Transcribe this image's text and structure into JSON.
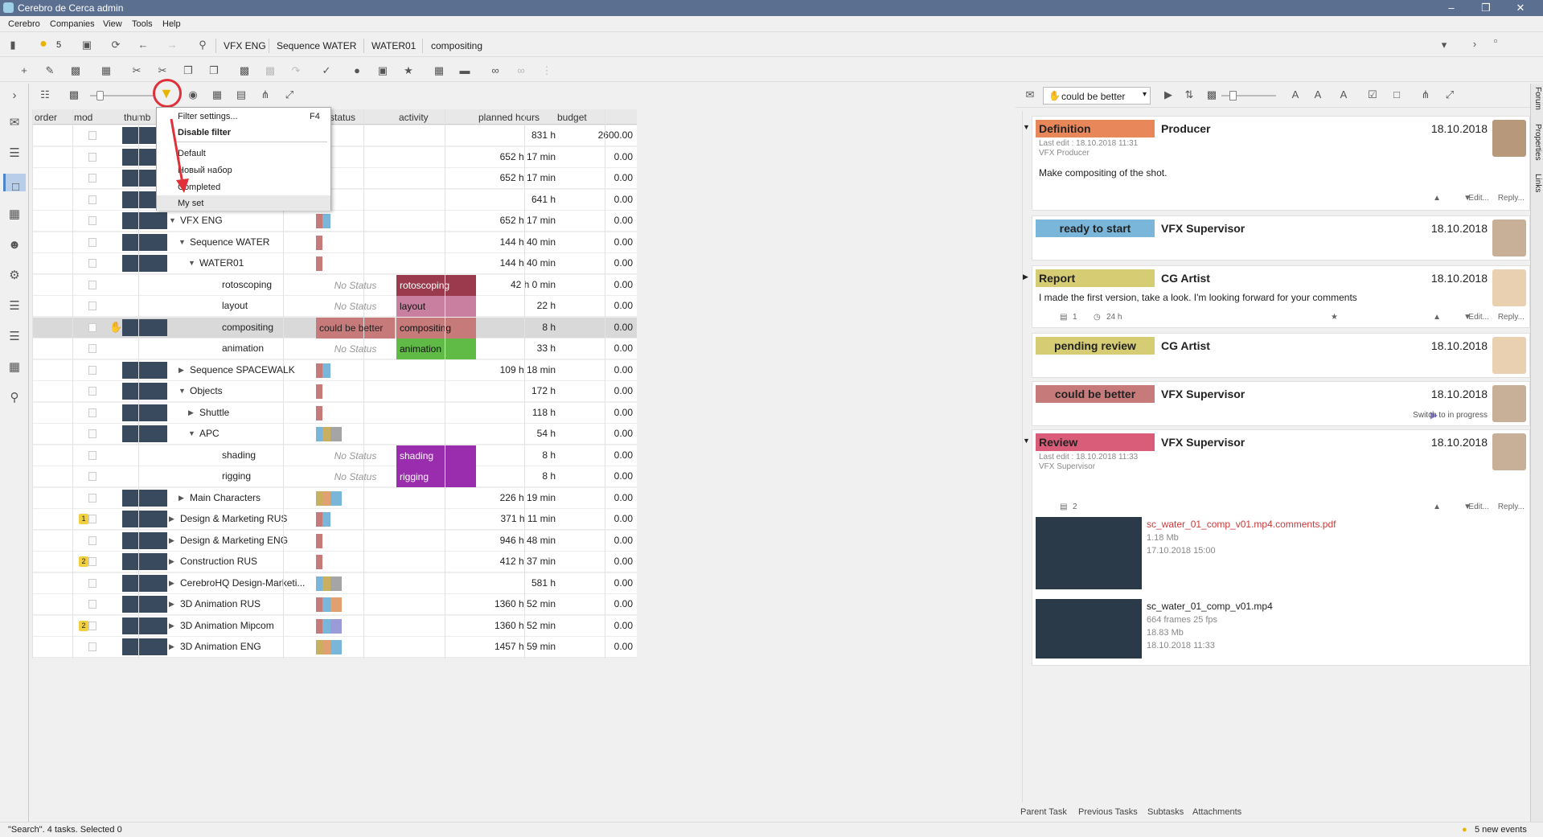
{
  "app": {
    "title": "Cerebro de Cerca  admin"
  },
  "menu": [
    "Cerebro",
    "Companies",
    "View",
    "Tools",
    "Help"
  ],
  "address": {
    "badge": "5",
    "crumbs": [
      "VFX ENG",
      "Sequence WATER",
      "WATER01",
      "compositing"
    ]
  },
  "columns": [
    "order",
    "mod",
    "thumb",
    "status",
    "activity",
    "planned hours",
    "budget"
  ],
  "filter_menu": {
    "items": [
      "Filter settings...",
      "Disable filter",
      "Default",
      "Новый набор",
      "Completed",
      "My set"
    ],
    "shortcut": "F4"
  },
  "rows": [
    {
      "name": "",
      "planned": "831 h",
      "budget": "2600.00",
      "indent": 0
    },
    {
      "name": "",
      "planned": "652 h 17 min",
      "budget": "0.00",
      "indent": 0
    },
    {
      "name": "",
      "planned": "652 h 17 min",
      "budget": "0.00",
      "indent": 0
    },
    {
      "name": "",
      "planned": "641 h",
      "budget": "0.00",
      "indent": 0
    },
    {
      "name": "VFX ENG",
      "planned": "652 h 17 min",
      "budget": "0.00",
      "indent": 0
    },
    {
      "name": "Sequence WATER",
      "planned": "144 h 40 min",
      "budget": "0.00",
      "indent": 1
    },
    {
      "name": "WATER01",
      "planned": "144 h 40 min",
      "budget": "0.00",
      "indent": 2
    },
    {
      "name": "rotoscoping",
      "status": "No Status",
      "activity": "rotoscoping",
      "planned": "42 h 0 min",
      "budget": "0.00",
      "indent": 3
    },
    {
      "name": "layout",
      "status": "No Status",
      "activity": "layout",
      "planned": "22 h",
      "budget": "0.00",
      "indent": 3
    },
    {
      "name": "compositing",
      "status": "could be better",
      "activity": "compositing",
      "planned": "8 h",
      "budget": "0.00",
      "indent": 3
    },
    {
      "name": "animation",
      "status": "No Status",
      "activity": "animation",
      "planned": "33 h",
      "budget": "0.00",
      "indent": 3
    },
    {
      "name": "Sequence SPACEWALK",
      "planned": "109 h 18 min",
      "budget": "0.00",
      "indent": 1
    },
    {
      "name": "Objects",
      "planned": "172 h",
      "budget": "0.00",
      "indent": 1
    },
    {
      "name": "Shuttle",
      "planned": "118 h",
      "budget": "0.00",
      "indent": 2
    },
    {
      "name": "APC",
      "planned": "54 h",
      "budget": "0.00",
      "indent": 2
    },
    {
      "name": "shading",
      "status": "No Status",
      "activity": "shading",
      "planned": "8 h",
      "budget": "0.00",
      "indent": 3
    },
    {
      "name": "rigging",
      "status": "No Status",
      "activity": "rigging",
      "planned": "8 h",
      "budget": "0.00",
      "indent": 3
    },
    {
      "name": "Main Characters",
      "planned": "226 h 19 min",
      "budget": "0.00",
      "indent": 1
    },
    {
      "name": "Design & Marketing RUS",
      "planned": "371 h 11 min",
      "budget": "0.00",
      "indent": 0,
      "badge": "1"
    },
    {
      "name": "Design & Marketing ENG",
      "planned": "946 h 48 min",
      "budget": "0.00",
      "indent": 0
    },
    {
      "name": "Construction RUS",
      "planned": "412 h 37 min",
      "budget": "0.00",
      "indent": 0,
      "badge": "2"
    },
    {
      "name": "CerebroHQ Design-Marketi...",
      "planned": "581 h",
      "budget": "0.00",
      "indent": 0
    },
    {
      "name": "3D Animation RUS",
      "planned": "1360 h 52 min",
      "budget": "0.00",
      "indent": 0
    },
    {
      "name": "3D Animation Mipcom",
      "planned": "1360 h 52 min",
      "budget": "0.00",
      "indent": 0,
      "badge": "2"
    },
    {
      "name": "3D Animation ENG",
      "planned": "1457 h 59 min",
      "budget": "0.00",
      "indent": 0
    }
  ],
  "right": {
    "status_select": "could be better",
    "cards": [
      {
        "tag": "Definition",
        "role": "Producer",
        "date": "18.10.2018",
        "sub1": "Last edit : 18.10.2018 11:31",
        "sub2": "VFX Producer",
        "text": "Make compositing of the shot.",
        "edit": "Edit...",
        "reply": "Reply..."
      },
      {
        "tag": "ready to start",
        "role": "VFX Supervisor",
        "date": "18.10.2018"
      },
      {
        "tag": "Report",
        "role": "CG Artist",
        "date": "18.10.2018",
        "text": "I made the first version, take a look. I'm looking forward for your comments",
        "count": "1",
        "time": "24 h",
        "edit": "Edit...",
        "reply": "Reply..."
      },
      {
        "tag": "pending review",
        "role": "CG Artist",
        "date": "18.10.2018"
      },
      {
        "tag": "could be better",
        "role": "VFX Supervisor",
        "date": "18.10.2018",
        "note": "Switch to in progress"
      },
      {
        "tag": "Review",
        "role": "VFX Supervisor",
        "date": "18.10.2018",
        "sub1": "Last edit : 18.10.2018 11:33",
        "sub2": "VFX Supervisor",
        "count": "2",
        "edit": "Edit...",
        "reply": "Reply..."
      }
    ],
    "files": [
      {
        "name": "sc_water_01_comp_v01.mp4.comments.pdf",
        "l1": "1.18 Mb",
        "l2": "17.10.2018 15:00",
        "l3": ""
      },
      {
        "name": "sc_water_01_comp_v01.mp4",
        "l1": "664 frames 25 fps",
        "l2": "18.83 Mb",
        "l3": "18.10.2018 11:33"
      }
    ],
    "tabs": [
      "Parent Task",
      "Previous Tasks",
      "Subtasks",
      "Attachments"
    ],
    "side": [
      "Forum",
      "Properties",
      "Links"
    ]
  },
  "status": {
    "left": "\"Search\". 4 tasks. Selected 0",
    "right": "5 new events"
  },
  "colors": {
    "accent": "#4a86c8",
    "title": "#5b6f91",
    "red_mark": "#e0303a"
  }
}
